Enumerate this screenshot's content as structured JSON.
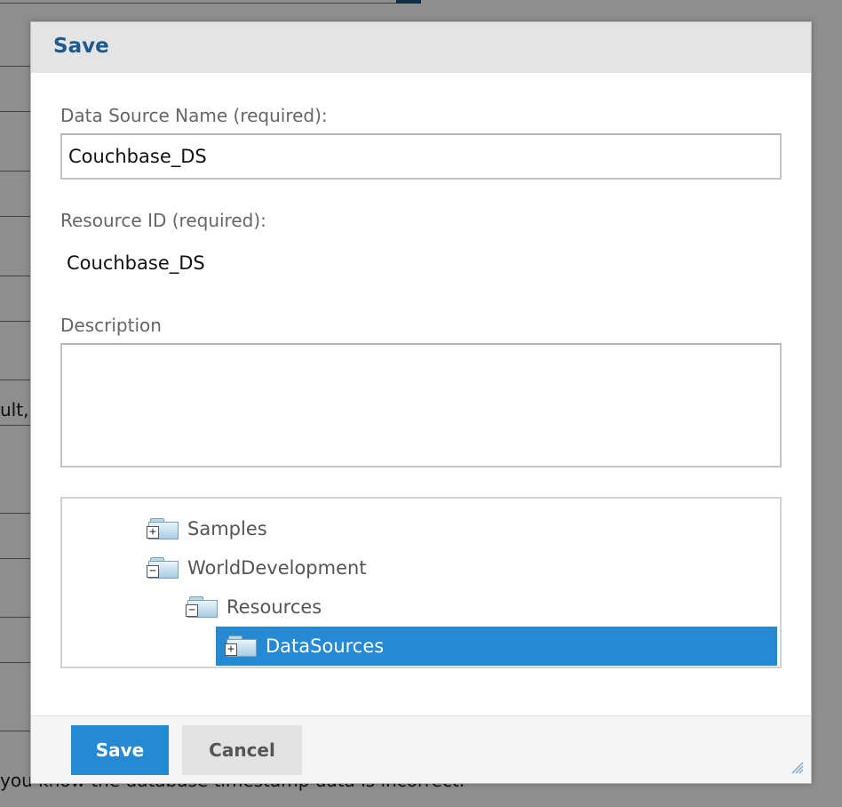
{
  "background": {
    "left_text": "ult,",
    "bottom_text": "you know the database timestamp data is incorrect."
  },
  "dialog": {
    "title": "Save",
    "fields": {
      "data_source_name_label": "Data Source Name (required):",
      "data_source_name_value": "Couchbase_DS",
      "resource_id_label": "Resource ID (required):",
      "resource_id_value": "Couchbase_DS",
      "description_label": "Description",
      "description_value": ""
    },
    "tree": {
      "items": [
        {
          "label": "Samples",
          "toggle": "+",
          "expanded": false,
          "selected": false
        },
        {
          "label": "WorldDevelopment",
          "toggle": "−",
          "expanded": true,
          "selected": false
        },
        {
          "label": "Resources",
          "toggle": "−",
          "expanded": true,
          "selected": false
        },
        {
          "label": "DataSources",
          "toggle": "+",
          "expanded": false,
          "selected": true
        }
      ]
    },
    "buttons": {
      "save_label": "Save",
      "cancel_label": "Cancel"
    }
  },
  "colors": {
    "accent": "#2589d3",
    "title": "#1e5a8a",
    "header_bg": "#e4e4e4"
  }
}
